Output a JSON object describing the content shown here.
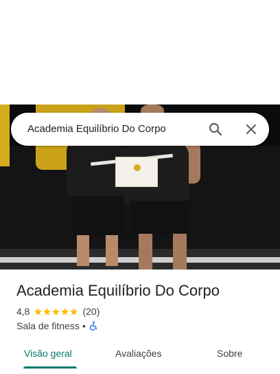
{
  "search": {
    "query": "Academia Equilíbrio Do Corpo",
    "search_icon": "search-icon",
    "close_icon": "close-icon"
  },
  "place": {
    "name": "Academia Equilíbrio Do Corpo",
    "rating": "4,8",
    "stars": 5,
    "review_count": "(20)",
    "category": "Sala de fitness",
    "separator": "•",
    "accessibility_icon": "wheelchair-icon"
  },
  "tabs": [
    {
      "label": "Visão geral",
      "active": true
    },
    {
      "label": "Avaliações",
      "active": false
    },
    {
      "label": "Sobre",
      "active": false
    }
  ],
  "colors": {
    "accent": "#00796b",
    "star": "#fbbc04",
    "accessibility": "#1a73e8"
  }
}
